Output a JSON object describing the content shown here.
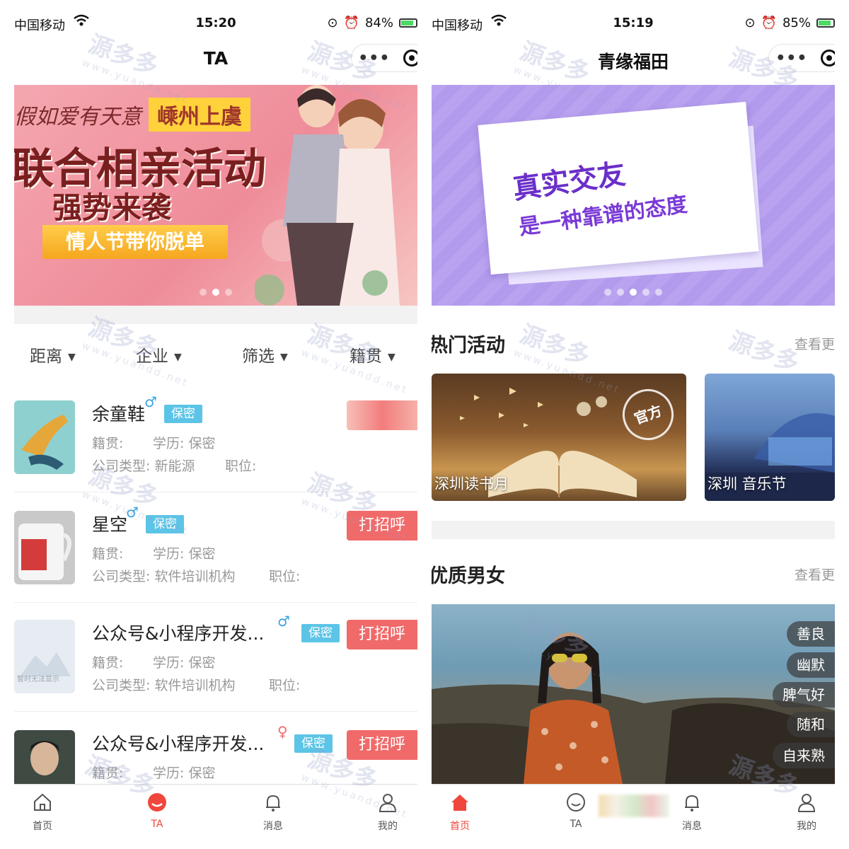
{
  "left": {
    "status": {
      "carrier": "中国移动",
      "time": "15:20",
      "battery": "84%",
      "battery_level": 0.84
    },
    "nav": {
      "title": "TA",
      "more": "•••"
    },
    "banner": {
      "line1": "假如爱有天意",
      "tag": "嵊州上虞",
      "headline": "联合相亲活动",
      "sub": "强势来袭",
      "ribbon": "情人节带你脱单",
      "slide_count": 3,
      "active_slide": 1
    },
    "filters": [
      {
        "label": "距离"
      },
      {
        "label": "企业"
      },
      {
        "label": "筛选"
      },
      {
        "label": "籍贯"
      }
    ],
    "users": [
      {
        "name": "余童鞋",
        "gender": "♂",
        "badge": "保密",
        "native": "籍贯:",
        "edu": "学历:  保密",
        "company": "公司类型:  新能源",
        "position": "职位:",
        "greet": "",
        "greet_blurred": true
      },
      {
        "name": "星空",
        "gender": "♂",
        "badge": "保密",
        "native": "籍贯:",
        "edu": "学历:  保密",
        "company": "公司类型:  软件培训机构",
        "position": "职位:",
        "greet": "打招呼",
        "greet_blurred": false
      },
      {
        "name": "公众号&小程序开发...",
        "gender": "♂",
        "badge": "保密",
        "native": "籍贯:",
        "edu": "学历:  保密",
        "company": "公司类型:  软件培训机构",
        "position": "职位:",
        "greet": "打招呼",
        "greet_blurred": false,
        "avatar_text": "暂时无法显示"
      },
      {
        "name": "公众号&小程序开发...",
        "gender": "♀",
        "badge": "保密",
        "native": "籍贯:",
        "edu": "学历:  保密",
        "greet": "打招呼",
        "greet_blurred": false
      }
    ],
    "tabbar": [
      {
        "label": "首页",
        "icon": "home-icon"
      },
      {
        "label": "TA",
        "icon": "ta-icon"
      },
      {
        "label": "消息",
        "icon": "bell-icon"
      },
      {
        "label": "我的",
        "icon": "user-icon"
      }
    ]
  },
  "right": {
    "status": {
      "carrier": "中国移动",
      "time": "15:19",
      "battery": "85%",
      "battery_level": 0.85
    },
    "nav": {
      "title": "青缘福田",
      "more": "•••"
    },
    "banner": {
      "line1": "真实交友",
      "line2": "是一种靠谱的态度",
      "slide_count": 5,
      "active_slide": 2
    },
    "hot": {
      "title": "热门活动",
      "more": "查看更",
      "items": [
        {
          "label": "深圳读书月",
          "badge": "官方"
        },
        {
          "label": "深圳 音乐节"
        }
      ]
    },
    "quality": {
      "title": "优质男女",
      "more": "查看更",
      "tags": [
        "善良",
        "幽默",
        "脾气好",
        "随和",
        "自来熟"
      ]
    },
    "tabbar": [
      {
        "label": "首页",
        "icon": "home-icon"
      },
      {
        "label": "TA",
        "icon": "ta-icon"
      },
      {
        "label": "消息",
        "icon": "bell-icon"
      },
      {
        "label": "我的",
        "icon": "user-icon"
      }
    ]
  },
  "watermark": {
    "text": "源多多",
    "url": "www.yuandd.net"
  },
  "colors": {
    "accent": "#f0473d",
    "greet": "#f06a6a",
    "badge": "#5cc4e6",
    "gender": "#3aa3e3"
  }
}
